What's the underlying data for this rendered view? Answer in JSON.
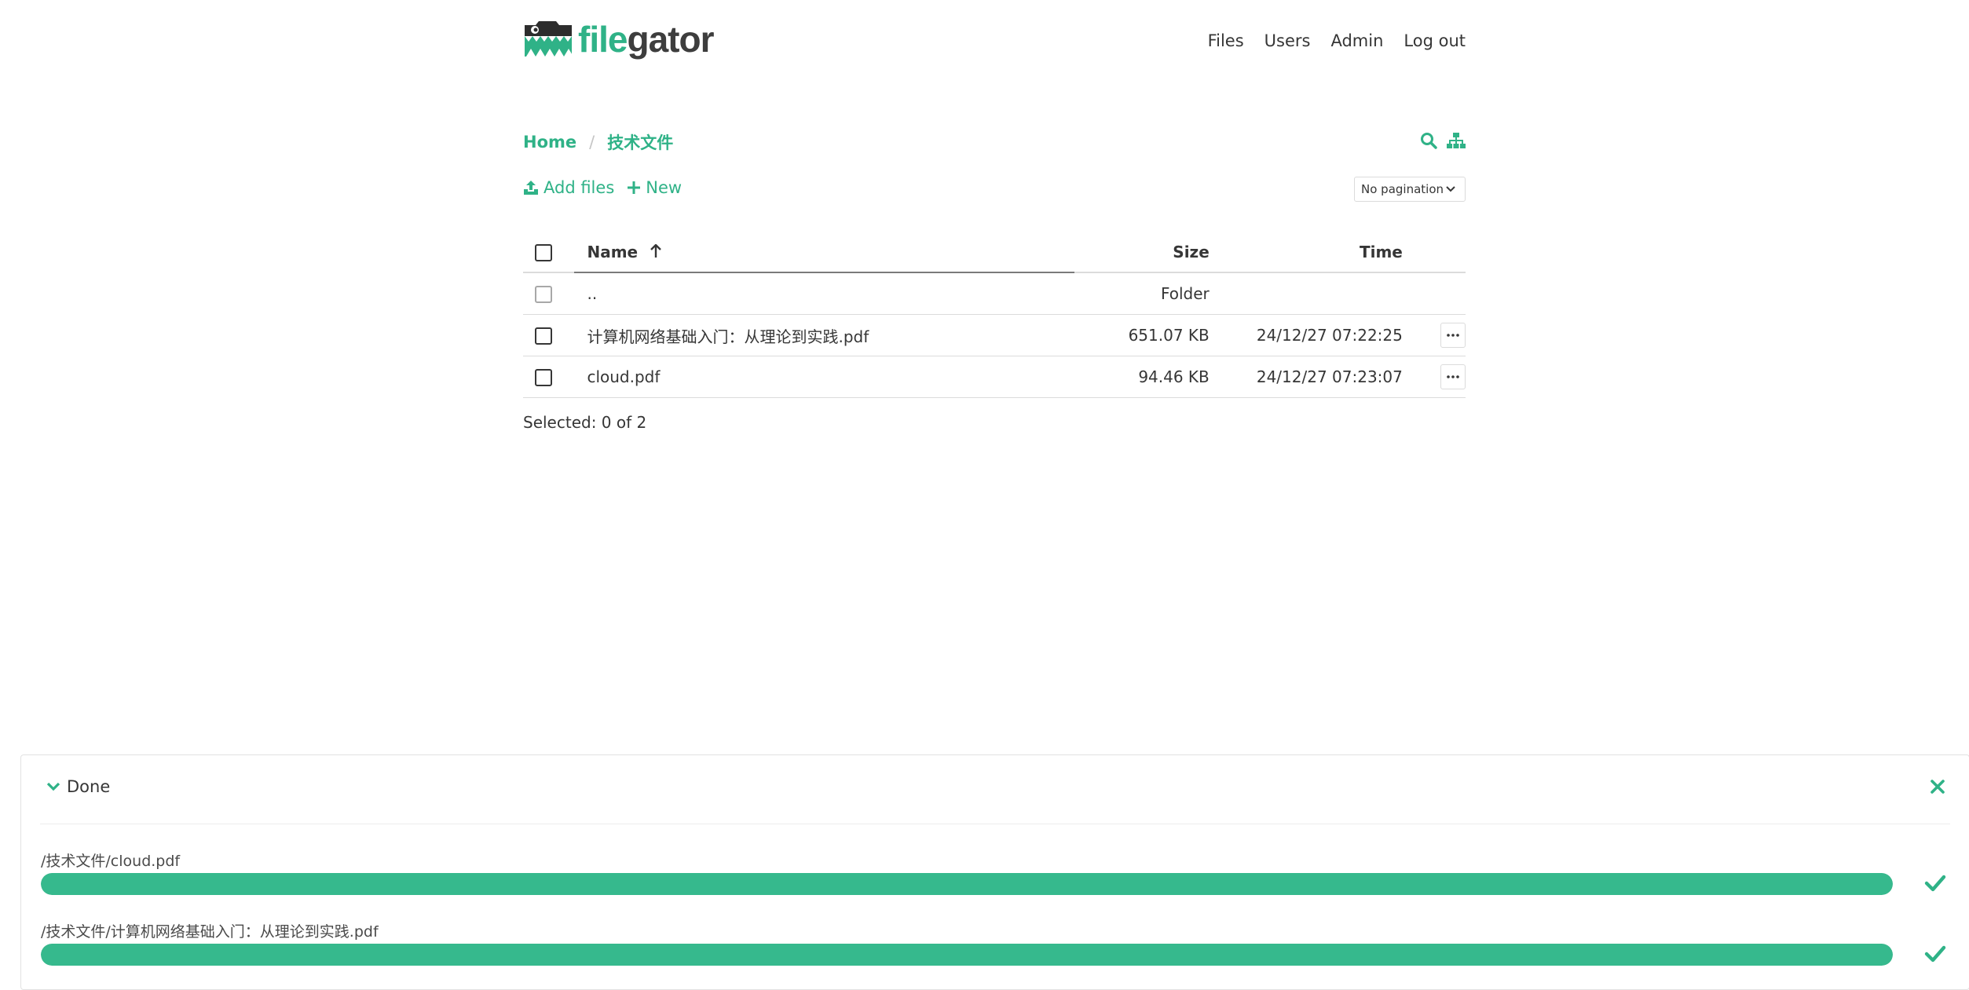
{
  "brand": {
    "part1": "file",
    "part2": "gator",
    "accent": "#2fb287"
  },
  "nav": {
    "files": "Files",
    "users": "Users",
    "admin": "Admin",
    "logout": "Log out"
  },
  "breadcrumb": {
    "home": "Home",
    "separator": "/",
    "current": "技术文件"
  },
  "actions": {
    "add_files": "Add files",
    "new": "New"
  },
  "pagination": {
    "selected": "No pagination"
  },
  "table": {
    "headers": {
      "name": "Name",
      "size": "Size",
      "time": "Time"
    },
    "sort": {
      "column": "Name",
      "direction": "ascending"
    },
    "parent_row": {
      "name": "..",
      "size": "Folder"
    },
    "rows": [
      {
        "name": "计算机网络基础入门：从理论到实践.pdf",
        "size": "651.07 KB",
        "time": "24/12/27 07:22:25"
      },
      {
        "name": "cloud.pdf",
        "size": "94.46 KB",
        "time": "24/12/27 07:23:07"
      }
    ]
  },
  "selection_status": "Selected: 0 of 2",
  "upload_panel": {
    "status": "Done",
    "items": [
      {
        "path": "/技术文件/cloud.pdf",
        "progress": 1.0
      },
      {
        "path": "/技术文件/计算机网络基础入门：从理论到实践.pdf",
        "progress": 1.0
      }
    ]
  },
  "icons": {
    "logo": "gator-folder-logo",
    "search": "search-icon",
    "tree": "sitemap-icon",
    "upload": "upload-icon",
    "plus": "plus-icon",
    "dropdown": "chevron-down-icon",
    "sort": "arrow-up-icon",
    "menu": "ellipsis-icon",
    "collapse": "chevron-down-icon",
    "close": "close-icon",
    "done": "check-icon"
  }
}
